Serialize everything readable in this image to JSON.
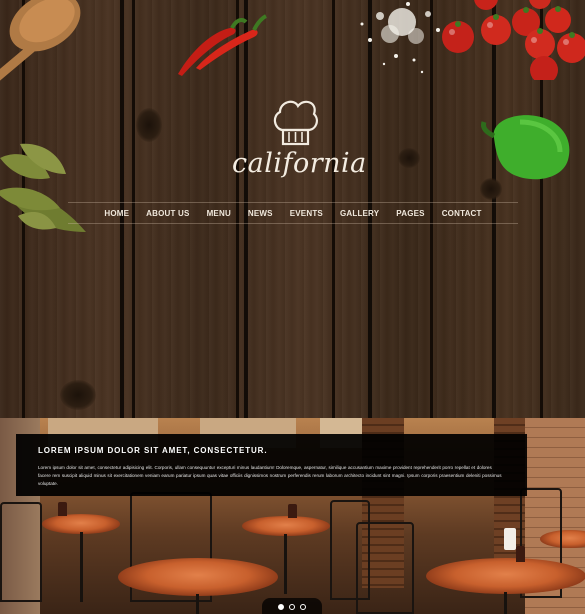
{
  "brand": {
    "logo_text": "california",
    "icon": "chef-hat-icon"
  },
  "nav": {
    "items": [
      {
        "label": "HOME"
      },
      {
        "label": "ABOUT US"
      },
      {
        "label": "MENU"
      },
      {
        "label": "NEWS"
      },
      {
        "label": "EVENTS"
      },
      {
        "label": "GALLERY"
      },
      {
        "label": "PAGES"
      },
      {
        "label": "CONTACT"
      }
    ]
  },
  "slider": {
    "caption_title": "LOREM IPSUM DOLOR SIT AMET, CONSECTETUR.",
    "caption_body": "Lorem ipsum dolor sit amet, consectetur adipisicing elit. Corporis, ullam consequuntur excepturi minus laudantium! Doloremque, aspernatur, similique accusantium maxime provident reprehenderit porro repellat et dolores facere rem suscipit aliquid minus sit exercitationem veniam earum pariatur ipsum quas vitae officiis dignissimos nostrum perferendis rerum laborum architecto incidunt sint magni. Ipsum corporis praesentium deleniti possimus voluptate.",
    "slides_total": 3,
    "active_slide": 1
  },
  "colors": {
    "nav_text": "#f0e8dc",
    "caption_bg": "#000000",
    "wood": "#3d2a1b"
  }
}
